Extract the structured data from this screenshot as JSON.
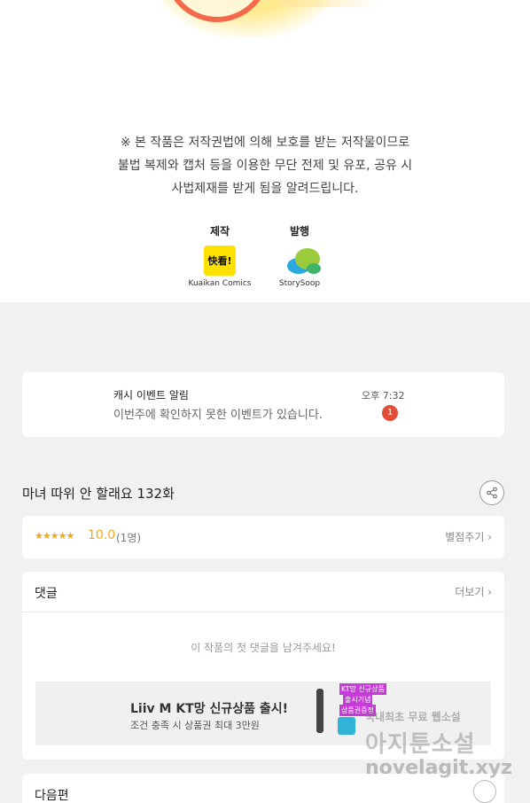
{
  "notice": {
    "line1": "※ 본 작품은 저작권법에 의해 보호를 받는 저작물이므로",
    "line2": "불법 복제와 캡처 등을 이용한 무단 전제 및 유포, 공유 시",
    "line3": "사법제재를 받게 됨을 알려드립니다."
  },
  "credits": {
    "production_label": "제작",
    "production_name": "Kuaikan Comics",
    "production_logo_text": "快看!",
    "publisher_label": "발행",
    "publisher_name": "StorySoop"
  },
  "push": {
    "title": "캐시 이벤트 알림",
    "text": "이번주에 확인하지 못한 이벤트가 있습니다.",
    "time": "오후 7:32",
    "badge": "1"
  },
  "episode": {
    "title": "마녀 따위 안 할래요 132화"
  },
  "rating": {
    "stars": "★★★★★",
    "score": "10.0",
    "raters": "(1명)",
    "rate_link": "별점주기 ›"
  },
  "comments": {
    "heading": "댓글",
    "more": "더보기 ›",
    "empty": "이 작품의 첫 댓글을 남겨주세요!"
  },
  "ad": {
    "title": "Liiv M KT망 신규상품 출시!",
    "subtitle": "조건 충족 시 상품권 최대 3만원",
    "tag1": "KT망 신규상품",
    "tag2": "출시기념",
    "tag3": "상품권증정"
  },
  "next": {
    "label": "다음편"
  },
  "watermark": {
    "line1": "국내최초 무료 웹소설",
    "line2": "아지툰소설",
    "line3": "novelagit.xyz"
  },
  "colors": {
    "accent_orange": "#f2a81d",
    "badge_red": "#e24e36",
    "kuaikan_yellow": "#ffe100"
  }
}
